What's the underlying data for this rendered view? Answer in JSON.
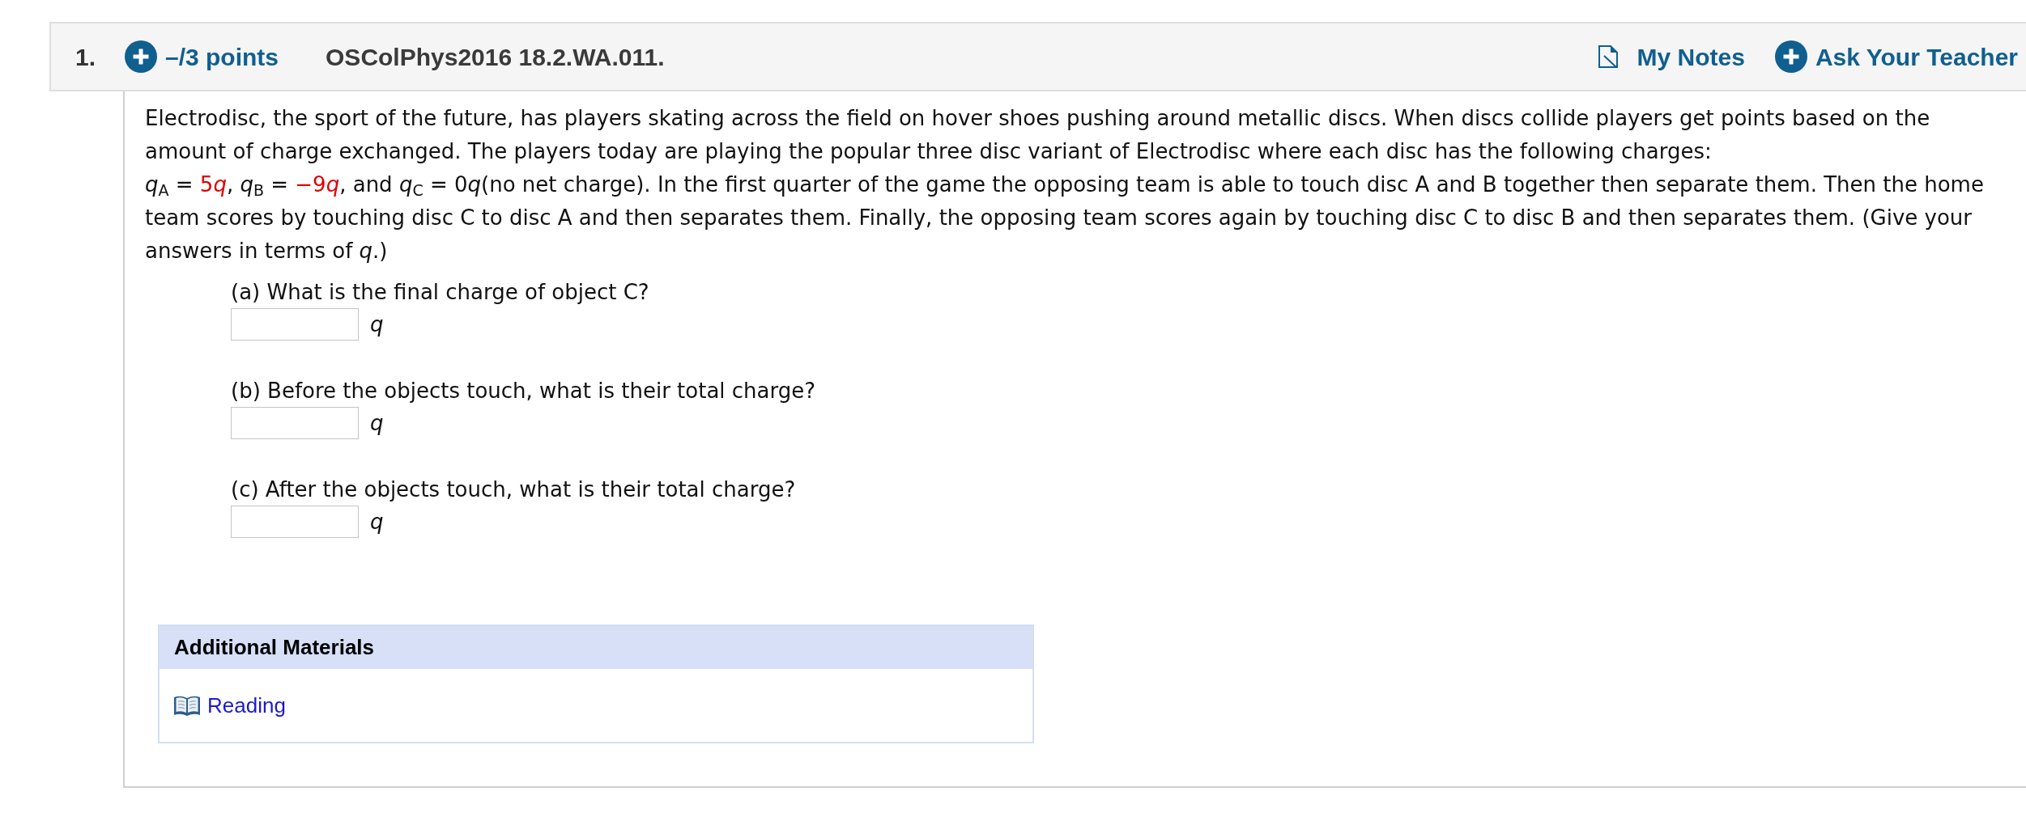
{
  "question": {
    "number": "1.",
    "points": "–/3 points",
    "id": "OSColPhys2016 18.2.WA.011.",
    "links": [
      {
        "kind": "notes",
        "label": "My Notes"
      },
      {
        "kind": "ask",
        "label": "Ask Your Teacher"
      }
    ]
  },
  "problem": {
    "intro": "Electrodisc, the sport of the future, has players skating across the field on hover shoes pushing around metallic discs. When discs collide players get points based on the amount of charge exchanged. The players today are playing the popular three disc variant of Electrodisc where each disc has the following charges:",
    "runs": [
      {
        "kind": "text",
        "text": "*q*$_{A}$ = "
      },
      {
        "kind": "value",
        "text": "5"
      },
      {
        "kind": "value",
        "text": "*q*"
      },
      {
        "kind": "text",
        "text": ", *q*$_{B}$ = "
      },
      {
        "kind": "value",
        "text": "−9"
      },
      {
        "kind": "value",
        "text": "*q*"
      },
      {
        "kind": "text",
        "text": ", and *q*$_{C}$ = 0"
      },
      {
        "kind": "text",
        "text": "*q*(no net charge). In the first quarter of the game the opposing team is able to touch disc A and B together then separate them. Then the home team scores by touching disc C to disc A and then separates them. Finally, the opposing team scores again by touching disc C to disc B and then separates them. (Give your answers in terms of *q*.)"
      }
    ]
  },
  "parts": [
    {
      "prompt": "(a) What is the final charge of object C?",
      "unit": "q"
    },
    {
      "prompt": "(b) Before the objects touch, what is their total charge?",
      "unit": "q"
    },
    {
      "prompt": "(c) After the objects touch, what is their total charge?",
      "unit": "q"
    }
  ],
  "additional_materials": {
    "title": "Additional Materials",
    "links": [
      {
        "kind": "reading",
        "label": "Reading"
      }
    ]
  }
}
